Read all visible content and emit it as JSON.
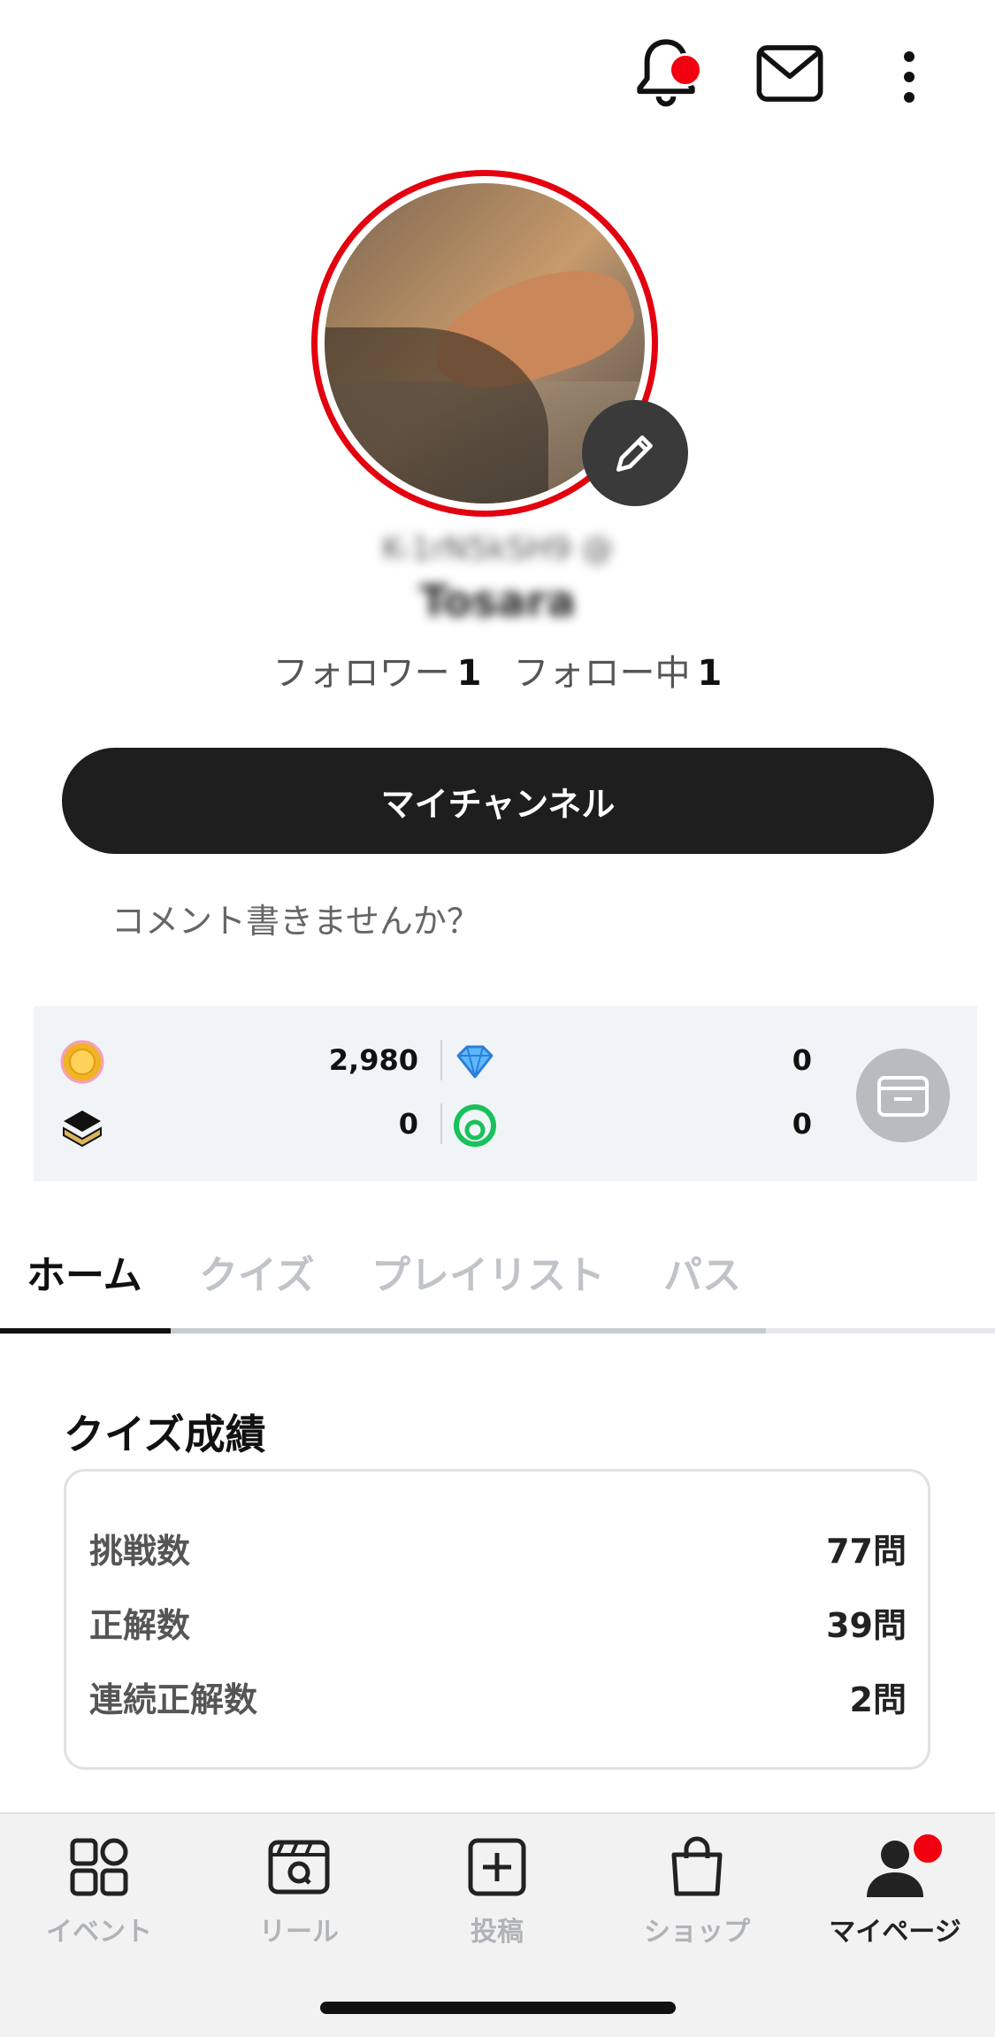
{
  "header": {
    "icons": [
      "bell-icon",
      "mail-icon",
      "more-vertical-icon"
    ],
    "notification_badge": true
  },
  "profile": {
    "user_id": "K-1rN5kSH9 @",
    "display_name": "Tosara",
    "followers_label": "フォロワー",
    "followers_count": "1",
    "following_label": "フォロー中",
    "following_count": "1",
    "ring_color": "#e3000f"
  },
  "my_channel_button": "マイチャンネル",
  "comment_prompt": "コメント書きませんか？",
  "wallet": {
    "coins": "2,980",
    "gems": "0",
    "tickets": "0",
    "points": "0"
  },
  "tabs": [
    {
      "label": "ホーム",
      "active": true
    },
    {
      "label": "クイズ",
      "active": false
    },
    {
      "label": "プレイリスト",
      "active": false
    },
    {
      "label": "パス",
      "active": false
    }
  ],
  "quiz_stats": {
    "title": "クイズ成績",
    "rows": [
      {
        "label": "挑戦数",
        "value": "77問"
      },
      {
        "label": "正解数",
        "value": "39問"
      },
      {
        "label": "連続正解数",
        "value": "2問"
      }
    ]
  },
  "bottom_nav": [
    {
      "label": "イベント",
      "icon": "grid-icon",
      "active": false
    },
    {
      "label": "リール",
      "icon": "clapperboard-icon",
      "active": false
    },
    {
      "label": "投稿",
      "icon": "plus-square-icon",
      "active": false
    },
    {
      "label": "ショップ",
      "icon": "shopping-bag-icon",
      "active": false
    },
    {
      "label": "マイページ",
      "icon": "person-icon",
      "active": true
    }
  ],
  "colors": {
    "accent": "#f2000f",
    "button_dark": "#1e1e1e",
    "wallet_bg": "#f1f4f7"
  }
}
